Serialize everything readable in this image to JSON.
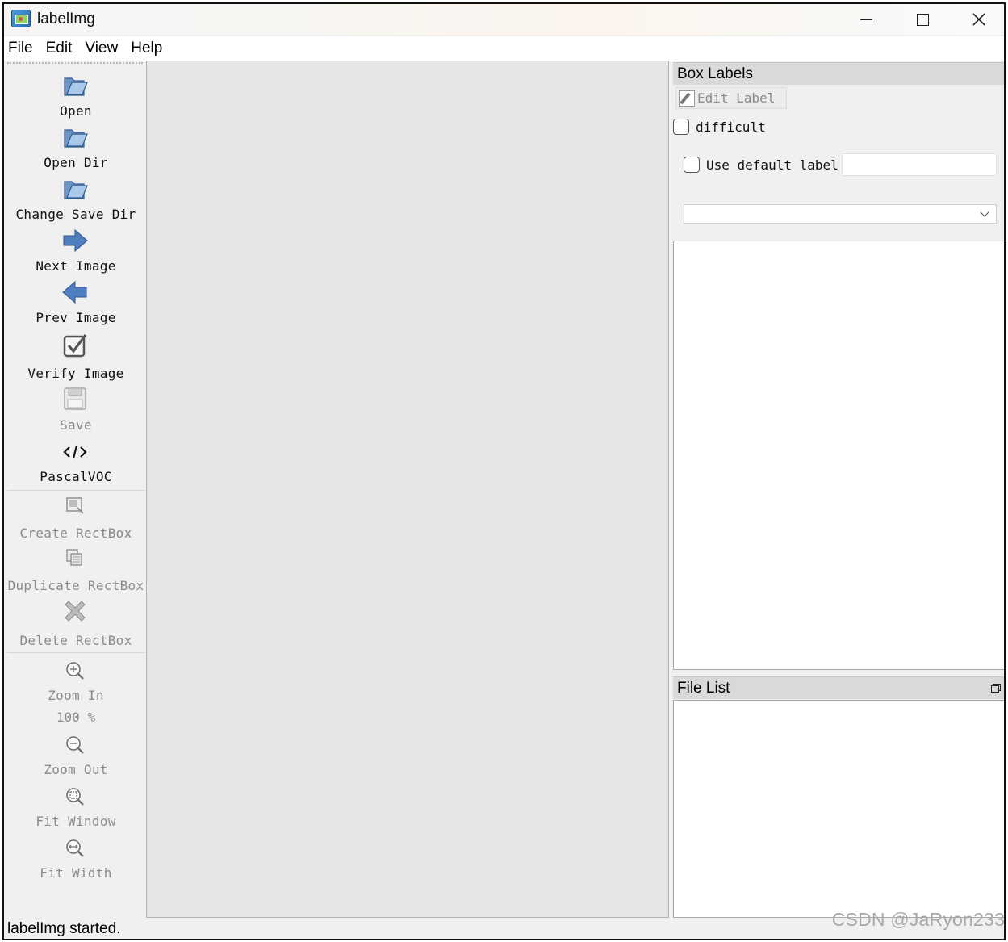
{
  "window": {
    "title": "labelImg",
    "controls": {
      "minimize": "minimize-icon",
      "maximize": "maximize-icon",
      "close": "close-icon"
    }
  },
  "menubar": {
    "items": [
      "File",
      "Edit",
      "View",
      "Help"
    ]
  },
  "toolbar": {
    "tools": [
      {
        "label": "Open",
        "icon": "folder-open-icon",
        "enabled": true
      },
      {
        "label": "Open Dir",
        "icon": "folder-open-icon",
        "enabled": true
      },
      {
        "label": "Change Save Dir",
        "icon": "folder-open-icon",
        "enabled": true
      },
      {
        "label": "Next Image",
        "icon": "arrow-right-icon",
        "enabled": true
      },
      {
        "label": "Prev Image",
        "icon": "arrow-left-icon",
        "enabled": true
      },
      {
        "label": "Verify Image",
        "icon": "checkbox-icon",
        "enabled": true
      },
      {
        "label": "Save",
        "icon": "save-icon",
        "enabled": false
      },
      {
        "label": "PascalVOC",
        "icon": "code-icon",
        "enabled": true
      },
      {
        "label": "Create RectBox",
        "icon": "create-rect-icon",
        "enabled": false
      },
      {
        "label": "Duplicate RectBox",
        "icon": "duplicate-rect-icon",
        "enabled": false
      },
      {
        "label": "Delete RectBox",
        "icon": "delete-x-icon",
        "enabled": false
      },
      {
        "label": "Zoom In",
        "icon": "zoom-in-icon",
        "enabled": false
      },
      {
        "label": "Zoom Out",
        "icon": "zoom-out-icon",
        "enabled": false
      },
      {
        "label": "Fit Window",
        "icon": "fit-window-icon",
        "enabled": false
      },
      {
        "label": "Fit Width",
        "icon": "fit-width-icon",
        "enabled": false
      }
    ],
    "zoom_value": "100 %"
  },
  "box_labels": {
    "title": "Box Labels",
    "edit_label": "Edit Label",
    "difficult_label": "difficult",
    "difficult_checked": false,
    "use_default_label": "Use default label",
    "use_default_checked": false,
    "default_label_value": "",
    "combo_value": ""
  },
  "file_list": {
    "title": "File List"
  },
  "statusbar": {
    "message": "labelImg started."
  },
  "watermark": "CSDN @JaRyon233"
}
